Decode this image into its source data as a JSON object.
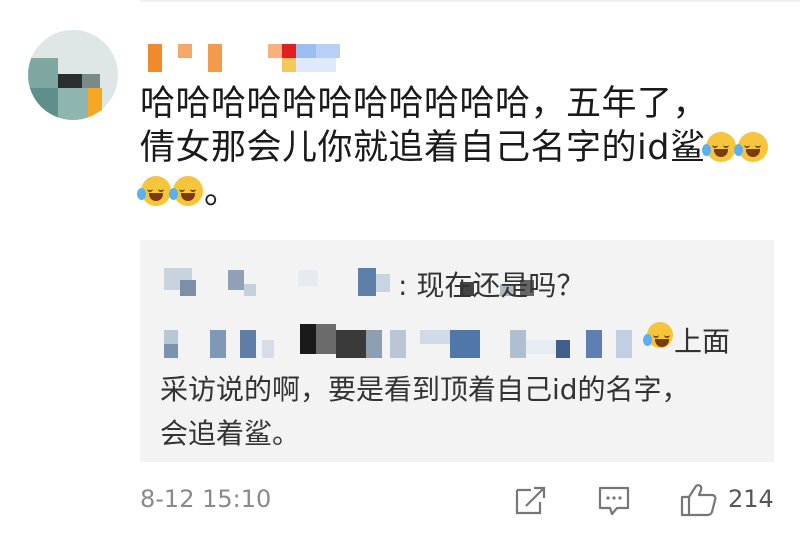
{
  "comment": {
    "lines": [
      "哈哈哈哈哈哈哈哈哈哈哈，五年了，",
      "倩女那会儿你就追着自己名字的id鲨",
      "。"
    ],
    "emoji_name": "laugh-cry-emoji"
  },
  "reply": {
    "line1_visible": ": 现在还是吗？",
    "line2_visible": "上面",
    "line3": "采访说的啊，要是看到顶着自己id的名字，",
    "line4": "会追着鲨。"
  },
  "footer": {
    "timestamp": "8-12 15:10",
    "like_count": "214"
  },
  "icons": {
    "share": "share-icon",
    "comment": "comment-icon",
    "like": "thumbs-up-icon"
  }
}
